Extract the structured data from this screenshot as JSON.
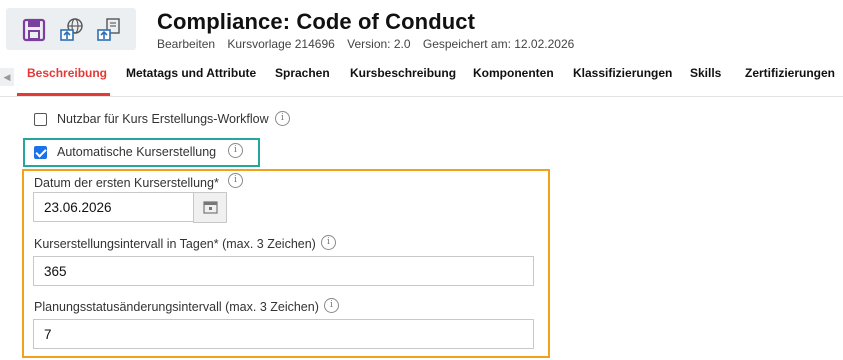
{
  "toolbar": {
    "icons": [
      "save-icon",
      "publish-network-icon",
      "publish-upload-icon"
    ]
  },
  "header": {
    "title": "Compliance: Code of Conduct",
    "meta": {
      "mode": "Bearbeiten",
      "template": "Kursvorlage 214696",
      "version": "Version: 2.0",
      "saved": "Gespeichert am: 12.02.2026"
    }
  },
  "tabs": [
    {
      "label": "Beschreibung",
      "active": true
    },
    {
      "label": "Metatags und Attribute"
    },
    {
      "label": "Sprachen"
    },
    {
      "label": "Kursbeschreibung"
    },
    {
      "label": "Komponenten"
    },
    {
      "label": "Klassifizierungen"
    },
    {
      "label": "Skills"
    },
    {
      "label": "Zertifizierungen"
    }
  ],
  "form": {
    "nutzbar": {
      "label": "Nutzbar für Kurs Erstellungs-Workflow",
      "checked": false
    },
    "automatisch": {
      "label": "Automatische Kurserstellung",
      "checked": true
    },
    "datum": {
      "label": "Datum der ersten Kurserstellung*",
      "value": "23.06.2026"
    },
    "intervall": {
      "label": "Kurserstellungsintervall in Tagen* (max. 3 Zeichen)",
      "value": "365"
    },
    "planung": {
      "label": "Planungsstatusänderungsintervall (max. 3 Zeichen)",
      "value": "7"
    }
  },
  "colors": {
    "accent": "#e53935",
    "checkbox": "#1a73e8",
    "highlight_green": "#26a69a",
    "highlight_orange": "#f0a21a"
  }
}
